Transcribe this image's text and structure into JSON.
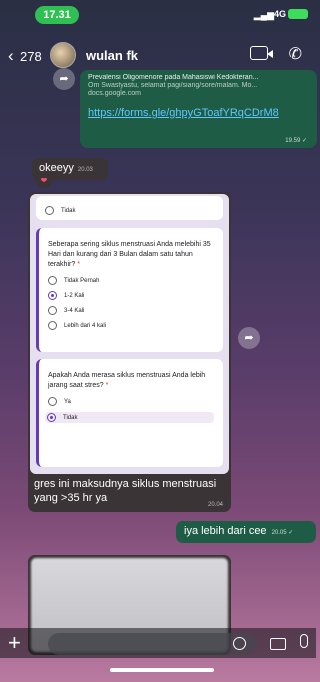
{
  "status_bar": {
    "time": "17.31",
    "signal": "▂▄▆",
    "network": "4G"
  },
  "header": {
    "back_glyph": "‹",
    "unread_count": "278",
    "contact_name": "wulan fk",
    "call_glyph": "✆"
  },
  "messages": {
    "forward_glyph": "➦",
    "link_preview": {
      "title": "Prevalensi Oligomenore pada Mahasiswi Kedokteran...",
      "description": "Om Swastyastu, selamat pagi/siang/sore/malam. Mo...",
      "domain": "docs.google.com",
      "url": "https://forms.gle/ghpyGToafYRqCDrM8",
      "time": "19.59 ✓"
    },
    "okeeyy": {
      "text": "okeeyy",
      "time": "20.03",
      "reaction": "❤"
    },
    "form_image": {
      "card1_option": "Tidak",
      "q1": "Seberapa sering siklus menstruasi Anda melebihi 35 Hari dan kurang dari 3 Bulan dalam satu tahun terakhir?",
      "q1_required": "*",
      "q1_options": [
        "Tidak Pernah",
        "1-2 Kali",
        "3-4 Kali",
        "Lebih dari 4 kali"
      ],
      "q2": "Apakah Anda merasa siklus menstruasi Anda lebih jarang saat stres?",
      "q2_required": "*",
      "q2_options": [
        "Ya",
        "Tidak"
      ]
    },
    "caption": {
      "text": "gres ini maksudnya siklus menstruasi yang >35 hr ya",
      "time": "20.04"
    },
    "reply": {
      "text": "iya lebih dari cee",
      "time": "20.05 ✓"
    }
  },
  "composer": {
    "plus": "+"
  }
}
